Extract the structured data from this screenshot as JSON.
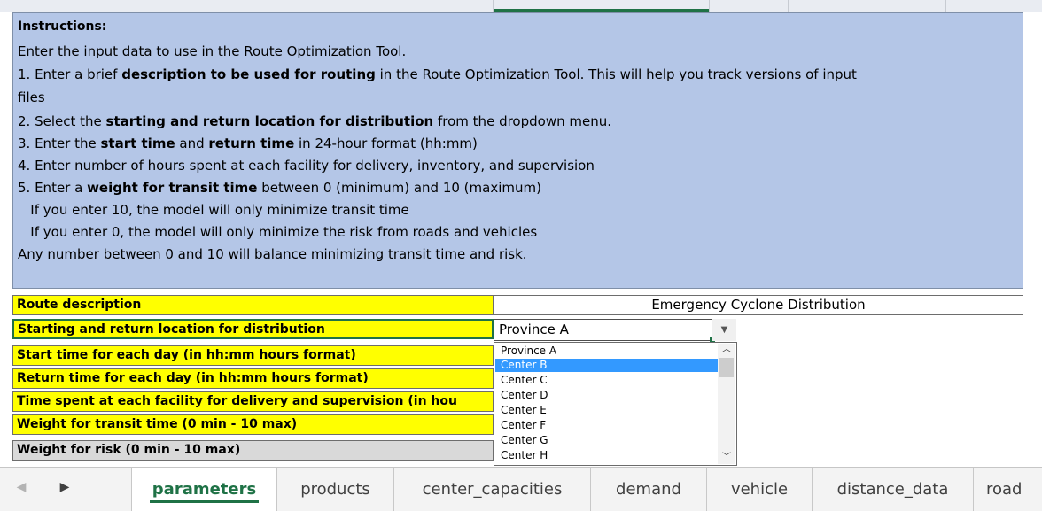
{
  "instructions": {
    "heading": "Instructions:",
    "intro": "Enter the input data to use in the Route Optimization Tool.",
    "step1": {
      "pre": "1. Enter a brief ",
      "bold": "description to be used for routing",
      "post": " in the Route Optimization Tool. This will help you track versions of input"
    },
    "step1_cont": "files",
    "step2": {
      "pre": "2. Select the ",
      "bold": "starting and return location for  distribution",
      "post": " from the dropdown menu."
    },
    "step3": {
      "pre": "3. Enter the ",
      "bold1": "start time",
      "mid": " and ",
      "bold2": "return time",
      "post": " in 24-hour format (hh:mm)"
    },
    "step4": "4. Enter number of hours spent at each facility for delivery, inventory, and supervision",
    "step5": {
      "pre": "5. Enter a ",
      "bold": "weight for transit time",
      "post": " between 0 (minimum) and 10 (maximum)"
    },
    "note1": "   If you enter 10, the model will only minimize transit time",
    "note2": "   If you enter 0, the model will only minimize the risk from roads and vehicles",
    "balance": "Any number between 0 and 10 will balance minimizing transit time and risk."
  },
  "form": {
    "route_description_label": "Route description",
    "route_description_value": "Emergency Cyclone Distribution",
    "start_location_label": "Starting and return location for distribution",
    "start_location_value": "Province A",
    "start_time_label": "Start time for each day (in hh:mm hours format)",
    "return_time_label": "Return time for each day (in hh:mm hours format)",
    "time_spent_label": "Time spent at each facility for delivery and supervision (in hou",
    "weight_transit_label": "Weight for transit time (0 min - 10 max)",
    "weight_risk_label": "Weight for risk (0 min - 10 max)"
  },
  "dropdown": {
    "options": [
      "Province A",
      "Center B",
      "Center C",
      "Center D",
      "Center E",
      "Center F",
      "Center G",
      "Center H"
    ],
    "highlighted": "Center B"
  },
  "tabs": [
    "parameters",
    "products",
    "center_capacities",
    "demand",
    "vehicle",
    "distance_data",
    "road"
  ],
  "active_tab": "parameters",
  "colors": {
    "instructions_bg": "#b4c6e7",
    "label_bg": "#ffff00",
    "label_gray_bg": "#d9d9d9",
    "excel_green": "#1f7246",
    "selection_blue": "#3399ff"
  },
  "icons": {
    "nav_prev": "triangle-left-icon",
    "nav_next": "triangle-right-icon",
    "dropdown_arrow": "triangle-down-icon",
    "scroll_up": "chevron-up-icon",
    "scroll_down": "chevron-down-icon"
  }
}
